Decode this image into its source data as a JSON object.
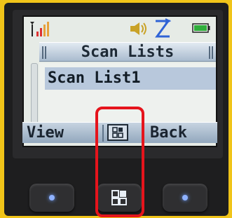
{
  "screen": {
    "title": "Scan Lists",
    "list": {
      "items": [
        {
          "label": "Scan List1",
          "selected": true
        }
      ]
    },
    "softkeys": {
      "left": "View",
      "middle_icon": "menu-grid-icon",
      "right": "Back"
    },
    "status_icons": [
      "signal-strength-icon",
      "volume-icon",
      "talk-around-icon",
      "battery-icon"
    ]
  },
  "hardware": {
    "keys": [
      {
        "name": "left-softkey",
        "icon": "blue-led-dot"
      },
      {
        "name": "menu-key",
        "icon": "menu-grid-icon"
      },
      {
        "name": "right-softkey",
        "icon": "blue-led-dot"
      }
    ]
  },
  "annotation": {
    "highlight_color": "#e5141c",
    "target": "menu-key"
  },
  "colors": {
    "lcd_background": "#e6ebe6",
    "selection": "#b8c8dc",
    "title_bar": "#a9bbce",
    "led": "#8fb2ff",
    "frame": "#f0c419"
  }
}
